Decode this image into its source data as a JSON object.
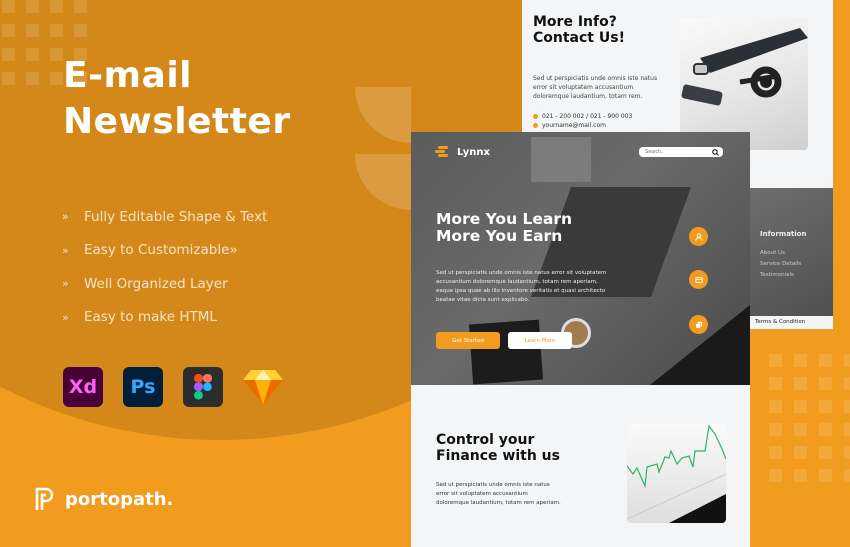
{
  "promo": {
    "title_line1": "E-mail",
    "title_line2": "Newsletter",
    "features": [
      {
        "bullet": "»",
        "text": "Fully Editable Shape & Text"
      },
      {
        "bullet": "»",
        "text": "Easy to Customizable»"
      },
      {
        "bullet": "»",
        "text": "Well Organized Layer"
      },
      {
        "bullet": "»",
        "text": "Easy to make HTML"
      }
    ],
    "tools": [
      {
        "name": "adobe-xd-icon",
        "label": "Xd"
      },
      {
        "name": "photoshop-icon",
        "label": "Ps"
      },
      {
        "name": "figma-icon",
        "label": ""
      },
      {
        "name": "sketch-icon",
        "label": ""
      }
    ],
    "brand": "portopath."
  },
  "contact": {
    "title_line1": "More Info?",
    "title_line2": "Contact Us!",
    "body": "Sed ut perspiciatis unde omnis iste natus error sit voluptatem accusantium doloremque laudantium, totam rem.",
    "phone": "021 - 200 002 / 021 - 900 003",
    "email": "yourname@mail.com"
  },
  "footer_panel": {
    "heading": "Information",
    "links": [
      "About Us",
      "Service Details",
      "Testimonials"
    ],
    "terms": "Terms & Condition"
  },
  "hero": {
    "logo": "Lynnx",
    "search_placeholder": "Search..",
    "headline_line1": "More You Learn",
    "headline_line2": "More You Earn",
    "body": "Sed ut perspiciatis unde omnis iste natus error sit voluptatem accusantium doloremque laudantium, totam rem aperiam, eaque ipsa quae ab illo inventore veritatis et quasi architecto beatae vitae dicta sunt explicabo.",
    "cta_primary": "Get Started",
    "cta_secondary": "Learn More",
    "fab_icons": [
      "user-icon",
      "card-icon",
      "copy-icon"
    ]
  },
  "finance": {
    "title_line1": "Control your",
    "title_line2": "Finance with us",
    "body": "Sed ut perspiciatis unde omnis iste natus error sit voluptatem accusantium doloremque laudantium, totam rem aperiam."
  },
  "colors": {
    "accent": "#f29c1f",
    "accent_dark": "#d4881a",
    "text_dark": "#111111"
  }
}
